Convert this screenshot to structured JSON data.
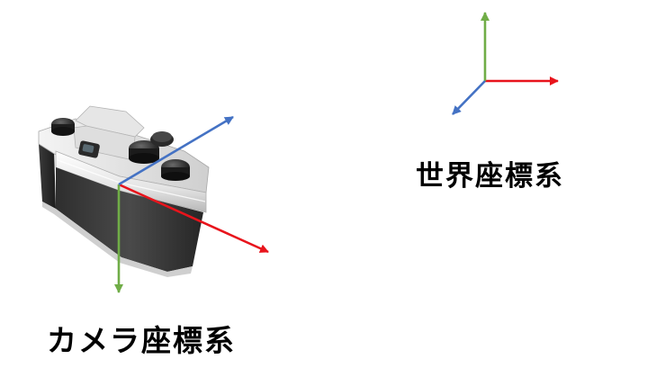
{
  "labels": {
    "world": "世界座標系",
    "camera": "カメラ座標系"
  },
  "colors": {
    "x_axis": "#e8141c",
    "y_axis": "#70ad47",
    "z_axis": "#4472c4",
    "background": "#ffffff",
    "text": "#000000"
  },
  "icons": {
    "camera": "film-camera-icon"
  }
}
